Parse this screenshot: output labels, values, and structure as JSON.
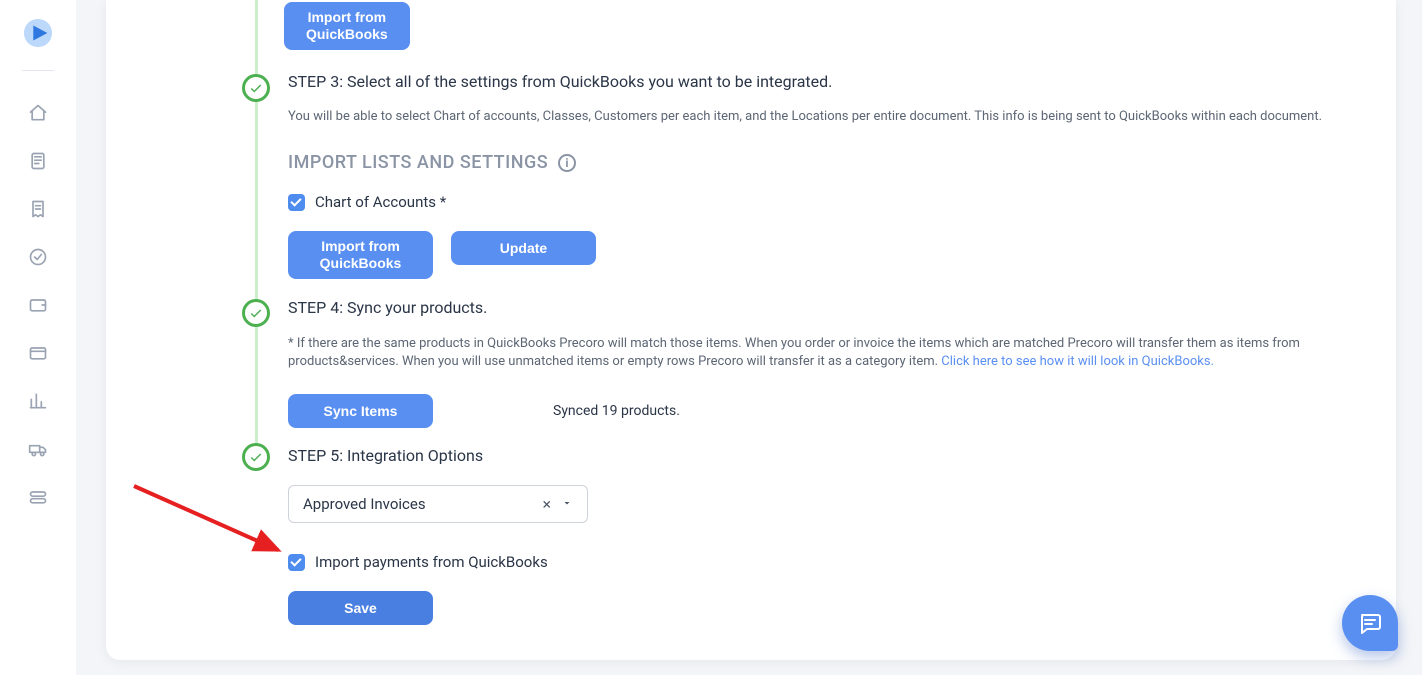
{
  "sidebar": {
    "items": [
      {
        "name": "home-icon"
      },
      {
        "name": "document-icon"
      },
      {
        "name": "receipt-icon"
      },
      {
        "name": "check-circle-icon"
      },
      {
        "name": "wallet-icon"
      },
      {
        "name": "card-icon"
      },
      {
        "name": "chart-icon"
      },
      {
        "name": "truck-icon"
      },
      {
        "name": "toggle-icon"
      }
    ]
  },
  "buttons": {
    "importFromQB1": "Import from",
    "importFromQB1b": "QuickBooks",
    "importFromQB2": "Import from",
    "importFromQB2b": "QuickBooks",
    "update": "Update",
    "syncItems": "Sync Items",
    "save": "Save"
  },
  "step3": {
    "title": "STEP 3: Select all of the settings from QuickBooks you want to be integrated.",
    "desc": "You will be able to select Chart of accounts, Classes, Customers per each item, and the Locations per entire document. This info is being sent to QuickBooks within each document.",
    "sectionTitle": "IMPORT LISTS AND SETTINGS",
    "chartOfAccounts": "Chart of Accounts *"
  },
  "step4": {
    "title": "STEP 4: Sync your products.",
    "descA": "* If there are the same products in QuickBooks Precoro will match those items. When you order or invoice the items which are matched Precoro will transfer them as items from products&services. When you will use unmatched items or empty rows Precoro will transfer it as a category item. ",
    "descLink": "Click here to see how it will look in QuickBooks.",
    "syncedMsg": "Synced 19 products."
  },
  "step5": {
    "title": "STEP 5: Integration Options",
    "selectValue": "Approved Invoices",
    "importPayments": "Import payments from QuickBooks"
  }
}
